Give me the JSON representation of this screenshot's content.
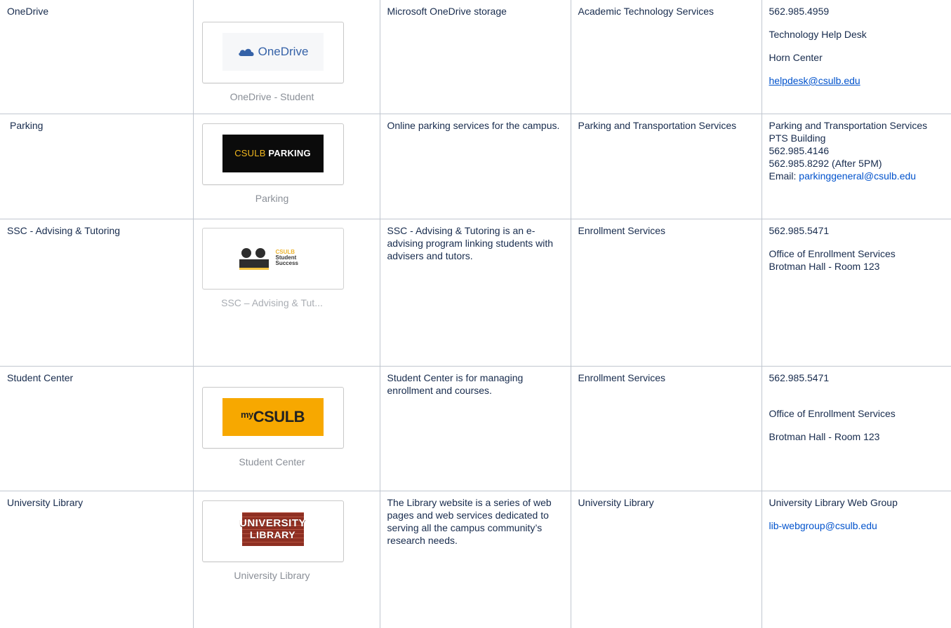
{
  "rows": [
    {
      "name": "OneDrive",
      "tile_logo": {
        "text": "OneDrive",
        "icon": "cloud-icon",
        "color": "#3562a8"
      },
      "tile_caption": "OneDrive - Student",
      "description": "Microsoft OneDrive storage",
      "department": "Academic Technology Services",
      "contact": {
        "phone": "562.985.4959",
        "line2": "Technology Help Desk",
        "line3": "Horn Center",
        "email": "helpdesk@csulb.edu"
      }
    },
    {
      "name": "Parking",
      "tile_logo": {
        "text_gold": "CSULB",
        "text_white": "PARKING",
        "colors": {
          "background": "#0b0b0b",
          "gold": "#f2b81e"
        }
      },
      "tile_caption": "Parking",
      "description": "Online parking services for the campus.",
      "department": "Parking and Transportation Services",
      "contact": {
        "line1": "Parking and Transportation Services",
        "line2": "PTS Building",
        "line3": "562.985.4146",
        "line4": "562.985.8292 (After 5PM)",
        "email_label": "Email:",
        "email": "parkinggeneral@csulb.edu"
      }
    },
    {
      "name": "SSC - Advising & Tutoring",
      "tile_logo": {
        "text1": "CSULB",
        "text2": "Student",
        "text3": "Success",
        "colors": {
          "gold": "#e9a80e"
        }
      },
      "tile_caption": "SSC – Advising & Tut...",
      "description": "SSC - Advising & Tutoring is an e-advising program linking students with advisers and tutors.",
      "department": "Enrollment Services",
      "contact": {
        "phone": "562.985.5471",
        "line2": "Office of Enrollment Services",
        "line3": "Brotman Hall - Room 123"
      }
    },
    {
      "name": "Student Center",
      "tile_logo": {
        "prefix": "my",
        "text": "CSULB",
        "colors": {
          "background": "#f7a800"
        }
      },
      "tile_caption": "Student Center",
      "description": "Student Center is for managing enrollment and courses.",
      "department": "Enrollment Services",
      "contact": {
        "phone": "562.985.5471",
        "line2": "Office of Enrollment Services",
        "line3": "Brotman Hall - Room 123"
      }
    },
    {
      "name": "University Library",
      "tile_logo": {
        "line1": "UNIVERSITY",
        "line2": "LIBRARY",
        "colors": {
          "brick": "#8e2f22"
        }
      },
      "tile_caption": "University Library",
      "description": "The Library website is a series of web pages and web services dedicated to serving all the campus community’s research needs.",
      "department": "University Library",
      "contact": {
        "line1": "University Library Web Group",
        "email": "lib-webgroup@csulb.edu"
      }
    }
  ],
  "colors": {
    "link": "#0052cc",
    "border": "#c1c7d0",
    "caption": "#8a8f97",
    "text": "#172b4d"
  }
}
